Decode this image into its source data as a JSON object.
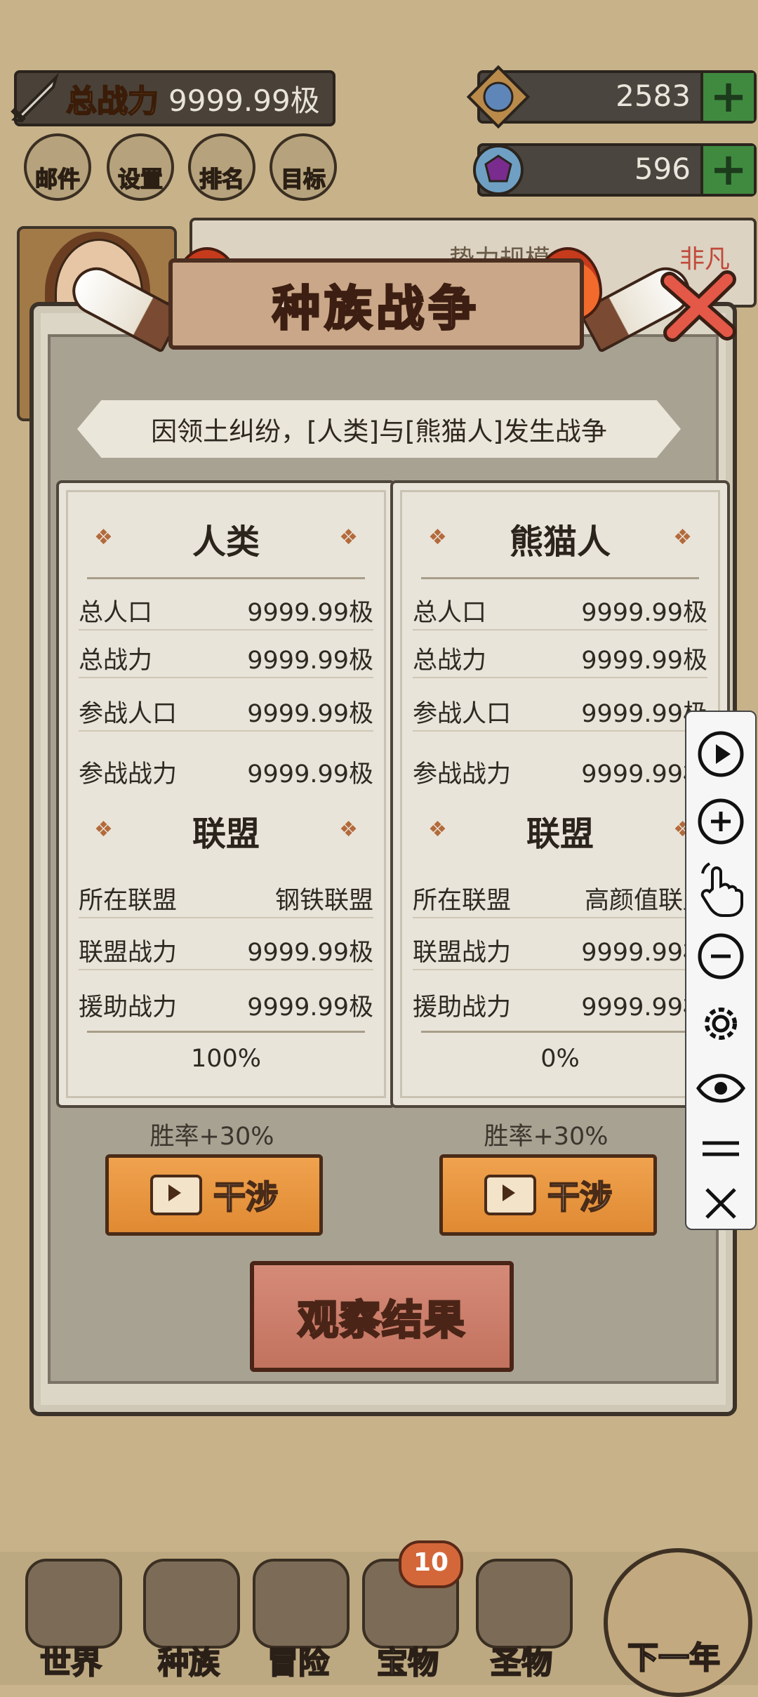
{
  "top": {
    "power_label": "总战力",
    "power_value": "9999.99极",
    "currency1": "2583",
    "currency2": "596"
  },
  "quick": [
    {
      "label": "邮件"
    },
    {
      "label": "设置"
    },
    {
      "label": "排名"
    },
    {
      "label": "目标"
    }
  ],
  "behind": {
    "title": "势力规模",
    "grade": "非凡"
  },
  "dialog": {
    "title": "种族战争",
    "cause": "因领土纠纷，[人类]与[熊猫人]发生战争",
    "left": {
      "race": "人类",
      "stats": [
        {
          "k": "总人口",
          "v": "9999.99极"
        },
        {
          "k": "总战力",
          "v": "9999.99极"
        },
        {
          "k": "参战人口",
          "v": "9999.99极"
        },
        {
          "k": "参战战力",
          "v": "9999.99极"
        }
      ],
      "alliance_title": "联盟",
      "alliance": [
        {
          "k": "所在联盟",
          "v": "钢铁联盟"
        },
        {
          "k": "联盟战力",
          "v": "9999.99极"
        },
        {
          "k": "援助战力",
          "v": "9999.99极"
        }
      ],
      "percent": "100%",
      "winrate": "胜率+30%",
      "btn": "干涉"
    },
    "right": {
      "race": "熊猫人",
      "stats": [
        {
          "k": "总人口",
          "v": "9999.99极"
        },
        {
          "k": "总战力",
          "v": "9999.99极"
        },
        {
          "k": "参战人口",
          "v": "9999.99极"
        },
        {
          "k": "参战战力",
          "v": "9999.99极"
        }
      ],
      "alliance_title": "联盟",
      "alliance": [
        {
          "k": "所在联盟",
          "v": "高颜值联盟"
        },
        {
          "k": "联盟战力",
          "v": "9999.99极"
        },
        {
          "k": "援助战力",
          "v": "9999.99极"
        }
      ],
      "percent": "0%",
      "winrate": "胜率+30%",
      "btn": "干涉"
    },
    "observe": "观察结果"
  },
  "nav": [
    {
      "label": "世界"
    },
    {
      "label": "种族"
    },
    {
      "label": "冒险"
    },
    {
      "label": "宝物",
      "badge": "10"
    },
    {
      "label": "圣物"
    },
    {
      "label": "下一年"
    }
  ],
  "floating_toolbar": [
    "play-icon",
    "zoom-in-icon",
    "touch-icon",
    "zoom-out-icon",
    "gear-icon",
    "eye-icon",
    "menu-icon",
    "close-icon"
  ]
}
